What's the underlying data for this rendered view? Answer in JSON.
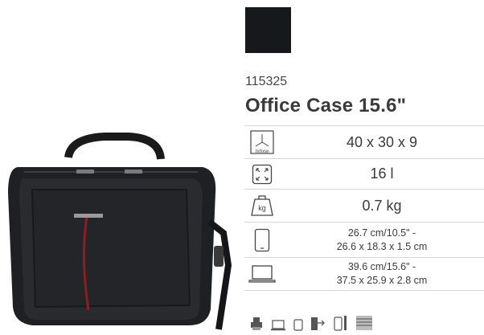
{
  "product": {
    "sku": "115325",
    "name": "Office Case 15.6\"",
    "color_swatch": "#17181b",
    "image_icon": "laptop-bag-image"
  },
  "specs": [
    {
      "icon": "dimensions-icon",
      "icon_text": "lxhxw",
      "value": "40 x 30 x 9"
    },
    {
      "icon": "volume-icon",
      "value": "16 l"
    },
    {
      "icon": "weight-icon",
      "icon_text": "kg",
      "value": "0.7 kg"
    },
    {
      "icon": "tablet-icon",
      "line1": "26.7 cm/10.5\" -",
      "line2": "26.6 x 18.3 x 1.5 cm"
    },
    {
      "icon": "laptop-icon",
      "line1": "39.6 cm/15.6\" -",
      "line2": "37.5 x 25.9 x 2.8 cm"
    }
  ],
  "feature_icons": [
    "printer-icon",
    "laptop-compartment-icon",
    "tablet-compartment-icon",
    "usb-icon",
    "phone-pocket-icon",
    "rfid-icon"
  ]
}
